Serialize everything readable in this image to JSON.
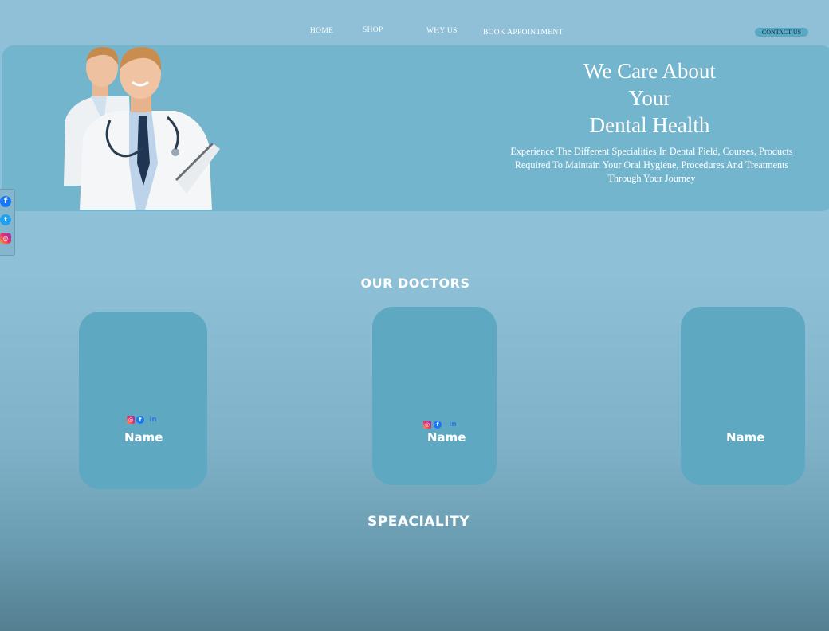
{
  "nav": {
    "home": "HOME",
    "shop": "SHOP",
    "why_us": "WHY US",
    "book": "BOOK APPOINTMENT",
    "contact": "CONTACT US"
  },
  "hero": {
    "title": "We Care About\nYour\nDental Health",
    "subtitle": "Experience The Different Specialities In Dental Field, Courses, Products Required To Maintain Your Oral Hygiene, Procedures And Treatments Through Your Journey"
  },
  "social_bar": {
    "icons": [
      "facebook-icon",
      "twitter-icon",
      "instagram-icon"
    ]
  },
  "sections": {
    "doctors_title": "OUR DOCTORS",
    "speciality_title": "SPEACIALITY"
  },
  "doctors": [
    {
      "name": "Name",
      "icons": [
        "instagram-icon",
        "facebook-icon",
        "linkedin-icon"
      ]
    },
    {
      "name": "Name",
      "icons": [
        "instagram-icon",
        "facebook-icon",
        "linkedin-icon"
      ]
    },
    {
      "name": "Name"
    }
  ],
  "colors": {
    "background": "#8ec0d7",
    "hero": "#74b5ce",
    "card": "#5ea8c2",
    "contact_button": "#5aa9c4"
  }
}
